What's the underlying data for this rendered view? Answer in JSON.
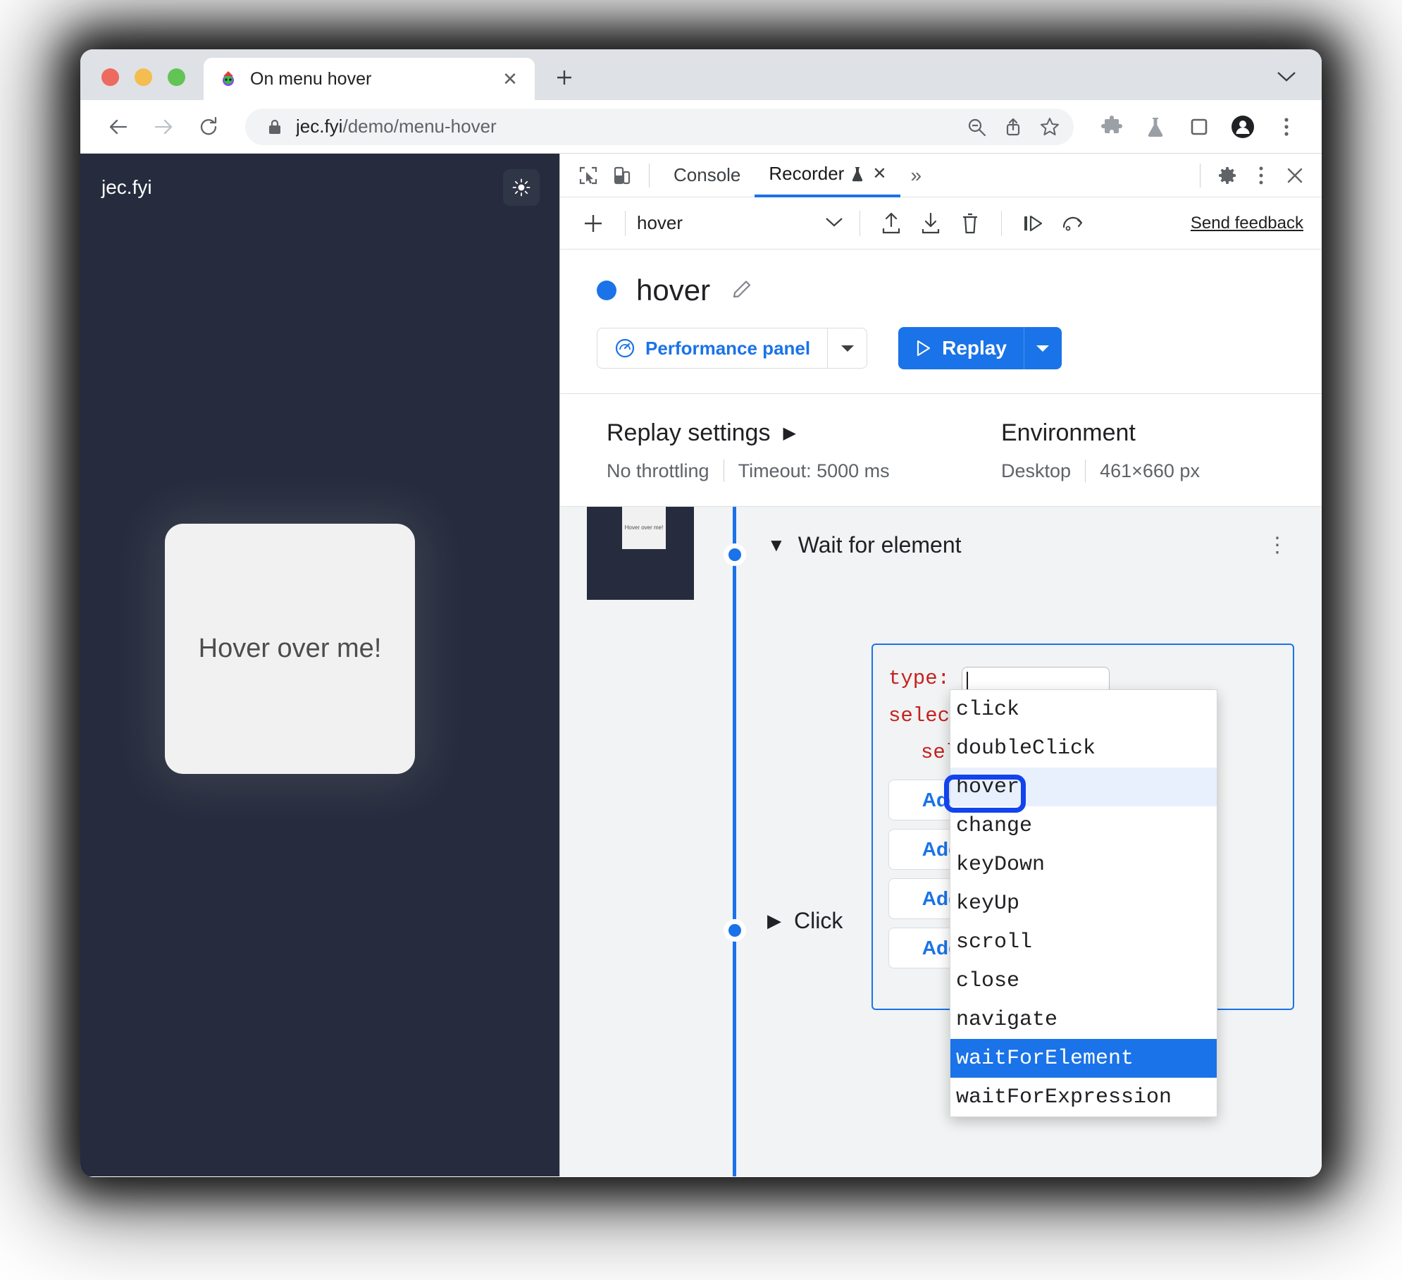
{
  "browser": {
    "tab": {
      "title": "On menu hover",
      "favicon": "party-face-favicon",
      "close_label": "✕"
    },
    "new_tab_label": "+",
    "tabstrip_caret": "⌄",
    "toolbar": {
      "back": "←",
      "forward": "→",
      "reload": "⟳",
      "lock": "lock-icon",
      "url_host": "jec.fyi",
      "url_path": "/demo/menu-hover",
      "icons": [
        "zoom-out-icon",
        "share-icon",
        "bookmark-star-icon",
        "extensions-puzzle-icon",
        "experiments-flask-icon",
        "side-panel-icon",
        "profile-avatar-icon",
        "chrome-menu-icon"
      ]
    }
  },
  "page": {
    "brand": "jec.fyi",
    "theme_toggle": "sun-icon",
    "card_label": "Hover over me!"
  },
  "devtools": {
    "tabbar": {
      "inspect_icon": "inspect-element-icon",
      "device_icon": "device-toolbar-icon",
      "tabs": [
        {
          "label": "Console",
          "active": false
        },
        {
          "label": "Recorder",
          "active": true,
          "experiment_icon": "flask-icon",
          "close": "✕"
        }
      ],
      "overflow": "»",
      "settings_icon": "gear-icon",
      "more_icon": "kebab-icon",
      "close_icon": "close-icon"
    },
    "recorder_toolbar": {
      "add": "+",
      "recording_name": "hover",
      "caret": "⌄",
      "export_icon": "export-icon",
      "import_icon": "import-icon",
      "delete_icon": "trash-icon",
      "step_icon": "step-over-icon",
      "slow_replay_icon": "replay-slow-icon",
      "feedback_label": "Send feedback"
    },
    "recording": {
      "status_dot_color": "#1a73e8",
      "title": "hover",
      "edit_icon": "pencil-icon",
      "perf_button": {
        "label": "Performance panel",
        "icon": "performance-icon",
        "caret": "▾"
      },
      "replay_button": {
        "label": "Replay",
        "icon": "play-icon",
        "caret": "▾"
      }
    },
    "settings": {
      "replay_title": "Replay settings",
      "replay_arrow": "▶",
      "throttling": "No throttling",
      "timeout": "Timeout: 5000 ms",
      "environment_title": "Environment",
      "device": "Desktop",
      "viewport": "461×660 px"
    },
    "steps": [
      {
        "label": "Wait for element",
        "caret": "▼",
        "expanded": true,
        "kebab": "⋮",
        "thumb_label": "Hover over me!"
      },
      {
        "label": "Click",
        "caret": "▶",
        "expanded": false,
        "kebab": "⋮"
      }
    ],
    "step_editor": {
      "type_key": "type:",
      "type_value": "",
      "select_key": "select",
      "selector_key": "sel",
      "add_buttons": [
        "Add",
        "Add",
        "Add",
        "Add"
      ]
    },
    "autocomplete": {
      "options": [
        {
          "label": "click",
          "state": "normal"
        },
        {
          "label": "doubleClick",
          "state": "normal"
        },
        {
          "label": "hover",
          "state": "hovered"
        },
        {
          "label": "change",
          "state": "normal"
        },
        {
          "label": "keyDown",
          "state": "normal"
        },
        {
          "label": "keyUp",
          "state": "normal"
        },
        {
          "label": "scroll",
          "state": "normal"
        },
        {
          "label": "close",
          "state": "normal"
        },
        {
          "label": "navigate",
          "state": "normal"
        },
        {
          "label": "waitForElement",
          "state": "selected"
        },
        {
          "label": "waitForExpression",
          "state": "normal"
        }
      ]
    }
  },
  "colors": {
    "accent_blue": "#1a73e8",
    "annotation_blue": "#1144ee",
    "page_bg": "#262c3d",
    "panel_bg": "#f1f3f4"
  }
}
